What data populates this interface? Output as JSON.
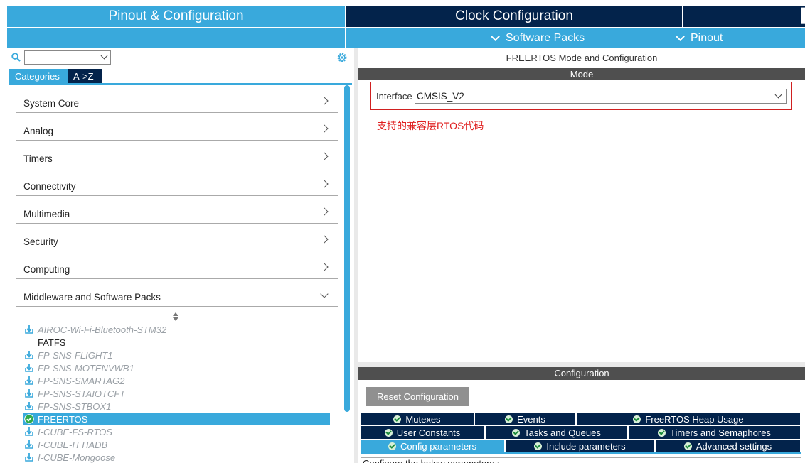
{
  "top_tabs": {
    "pinout": "Pinout & Configuration",
    "clock": "Clock Configuration",
    "software_packs": "Software Packs",
    "pinout_menu": "Pinout"
  },
  "left": {
    "search": {
      "value": ""
    },
    "tabs": {
      "categories": "Categories",
      "az": "A->Z"
    },
    "categories": [
      {
        "label": "System Core"
      },
      {
        "label": "Analog"
      },
      {
        "label": "Timers"
      },
      {
        "label": "Connectivity"
      },
      {
        "label": "Multimedia"
      },
      {
        "label": "Security"
      },
      {
        "label": "Computing"
      },
      {
        "label": "Middleware and Software Packs",
        "expanded": true
      }
    ],
    "middleware": [
      {
        "label": "AIROC-Wi-Fi-Bluetooth-STM32",
        "style": "italic",
        "icon": "download-icon"
      },
      {
        "label": "FATFS",
        "style": "plain",
        "icon": ""
      },
      {
        "label": "FP-SNS-FLIGHT1",
        "style": "italic",
        "icon": "download-icon"
      },
      {
        "label": "FP-SNS-MOTENVWB1",
        "style": "italic",
        "icon": "download-icon"
      },
      {
        "label": "FP-SNS-SMARTAG2",
        "style": "italic",
        "icon": "download-icon"
      },
      {
        "label": "FP-SNS-STAIOTCFT",
        "style": "italic",
        "icon": "download-icon"
      },
      {
        "label": "FP-SNS-STBOX1",
        "style": "italic",
        "icon": "download-icon"
      },
      {
        "label": "FREERTOS",
        "style": "selected",
        "icon": "check-icon"
      },
      {
        "label": "I-CUBE-FS-RTOS",
        "style": "italic",
        "icon": "download-icon"
      },
      {
        "label": "I-CUBE-ITTIADB",
        "style": "italic",
        "icon": "download-icon"
      },
      {
        "label": "I-CUBE-Mongoose",
        "style": "italic",
        "icon": "download-icon"
      }
    ]
  },
  "right": {
    "title": "FREERTOS Mode and Configuration",
    "mode_bar": "Mode",
    "interface_label": "Interface",
    "interface_value": "CMSIS_V2",
    "annotation": "支持的兼容层RTOS代码",
    "config_bar": "Configuration",
    "reset_button": "Reset Configuration",
    "tabs_row1": [
      "Mutexes",
      "Events",
      "FreeRTOS Heap Usage"
    ],
    "tabs_row2": [
      "User Constants",
      "Tasks and Queues",
      "Timers and Semaphores"
    ],
    "tabs_row3": [
      "Config parameters",
      "Include parameters",
      "Advanced settings"
    ],
    "active_tab": "Config parameters",
    "param_hint": "Configure the below parameters :"
  },
  "colors": {
    "accent_blue": "#39a9dc",
    "navy": "#03234b",
    "annotation_red": "#e02020"
  }
}
